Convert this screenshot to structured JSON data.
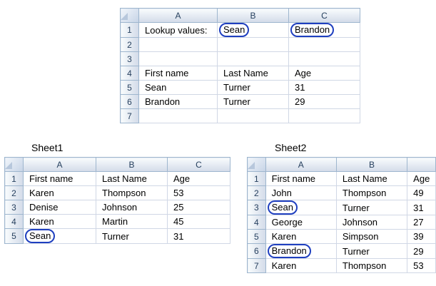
{
  "top": {
    "cols": [
      "A",
      "B",
      "C"
    ],
    "rows": [
      {
        "n": "1",
        "a": "Lookup values:",
        "b": "Sean",
        "c": "Brandon"
      },
      {
        "n": "2",
        "a": "",
        "b": "",
        "c": ""
      },
      {
        "n": "3",
        "a": "",
        "b": "",
        "c": ""
      },
      {
        "n": "4",
        "a": "First name",
        "b": "Last Name",
        "c": "Age"
      },
      {
        "n": "5",
        "a": "Sean",
        "b": "Turner",
        "c": "31"
      },
      {
        "n": "6",
        "a": "Brandon",
        "b": "Turner",
        "c": "29"
      },
      {
        "n": "7",
        "a": "",
        "b": "",
        "c": ""
      }
    ]
  },
  "sheet1": {
    "label": "Sheet1",
    "cols": [
      "A",
      "B",
      "C"
    ],
    "rows": [
      {
        "n": "1",
        "a": "First name",
        "b": "Last Name",
        "c": "Age"
      },
      {
        "n": "2",
        "a": "Karen",
        "b": "Thompson",
        "c": "53"
      },
      {
        "n": "3",
        "a": "Denise",
        "b": "Johnson",
        "c": "25"
      },
      {
        "n": "4",
        "a": "Karen",
        "b": "Martin",
        "c": "45"
      },
      {
        "n": "5",
        "a": "Sean",
        "b": "Turner",
        "c": "31"
      }
    ]
  },
  "sheet2": {
    "label": "Sheet2",
    "cols": [
      "A",
      "B",
      ""
    ],
    "rows": [
      {
        "n": "1",
        "a": "First name",
        "b": "Last Name",
        "c": "Age"
      },
      {
        "n": "2",
        "a": "John",
        "b": "Thompson",
        "c": "49"
      },
      {
        "n": "3",
        "a": "Sean",
        "b": "Turner",
        "c": "31"
      },
      {
        "n": "4",
        "a": "George",
        "b": "Johnson",
        "c": "27"
      },
      {
        "n": "5",
        "a": "Karen",
        "b": "Simpson",
        "c": "39"
      },
      {
        "n": "6",
        "a": "Brandon",
        "b": "Turner",
        "c": "29"
      },
      {
        "n": "7",
        "a": "Karen",
        "b": "Thompson",
        "c": "53"
      }
    ]
  },
  "highlight_color": "#1f3fbf"
}
